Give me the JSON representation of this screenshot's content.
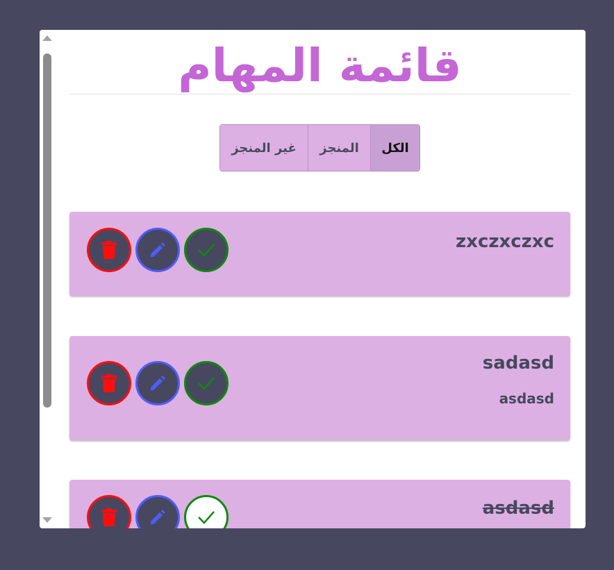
{
  "app": {
    "title": "قائمة المهام"
  },
  "filters": {
    "all_label": "الكل",
    "done_label": "المنجز",
    "undone_label": "غير المنجز",
    "active": "all"
  },
  "todos": [
    {
      "title": "zxczxczxc",
      "description": "",
      "completed": false
    },
    {
      "title": "sadasd",
      "description": "asdasd",
      "completed": false
    },
    {
      "title": "asdasd",
      "description": "",
      "completed": true
    }
  ],
  "icons": {
    "delete": "trash-icon",
    "edit": "pencil-icon",
    "complete": "checkmark-icon"
  },
  "colors": {
    "background": "#474860",
    "panel": "#ffffff",
    "title": "#c466d6",
    "card": "#ddb0e3",
    "filter_active": "#c9a0d4",
    "delete": "#ff0d0d",
    "edit": "#4f5cff",
    "done": "#0d8a0d"
  }
}
